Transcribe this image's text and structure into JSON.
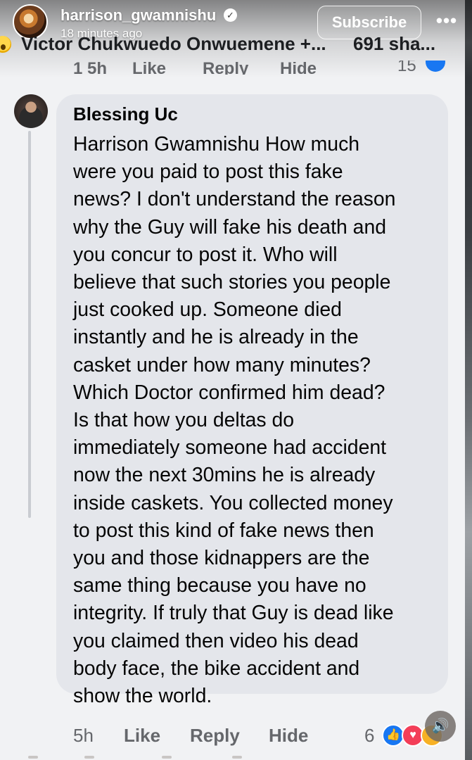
{
  "header": {
    "username": "harrison_gwamnishu",
    "time_ago": "18 minutes ago",
    "subscribe_label": "Subscribe",
    "more_icon": "more-dots-icon",
    "verified_icon": "verified-badge-icon"
  },
  "post": {
    "reaction_names": "Victor Chukwuedo Onwuemene +...",
    "shares": "691 sha...",
    "prev_comment_actions": [
      "1 5h",
      "Like",
      "Reply",
      "Hide"
    ],
    "prev_reaction_count": "15"
  },
  "comment": {
    "author": "Blessing Uc",
    "text_lines": [
      "Harrison Gwamnishu How much",
      "were you paid to post this fake",
      "news? I don't understand the reason",
      "why the Guy will fake his death and",
      "you concur to post it. Who will",
      "believe that such stories you people",
      "just cooked up. Someone died",
      "instantly and he is already in the",
      "casket under how many minutes?",
      "Which Doctor confirmed him dead?",
      "Is that how you deltas do",
      "immediately someone had accident",
      "now the next 30mins he is already",
      "inside caskets. You collected money",
      "to post this kind of fake news then",
      "you and those kidnappers are the",
      "same thing because you have no",
      "integrity. If truly that Guy is dead like",
      "you claimed then video his dead",
      "body face, the bike accident and",
      "show the world."
    ],
    "time": "5h",
    "like_label": "Like",
    "reply_label": "Reply",
    "hide_label": "Hide",
    "reaction_count": "6",
    "reactions": [
      "like-reaction-icon",
      "love-reaction-icon",
      "care-reaction-icon"
    ]
  },
  "colors": {
    "background": "#f1f2f4",
    "bubble": "#e4e6eb",
    "meta_text": "#65676b",
    "like_blue": "#1877f2",
    "love_red": "#f33e58"
  }
}
